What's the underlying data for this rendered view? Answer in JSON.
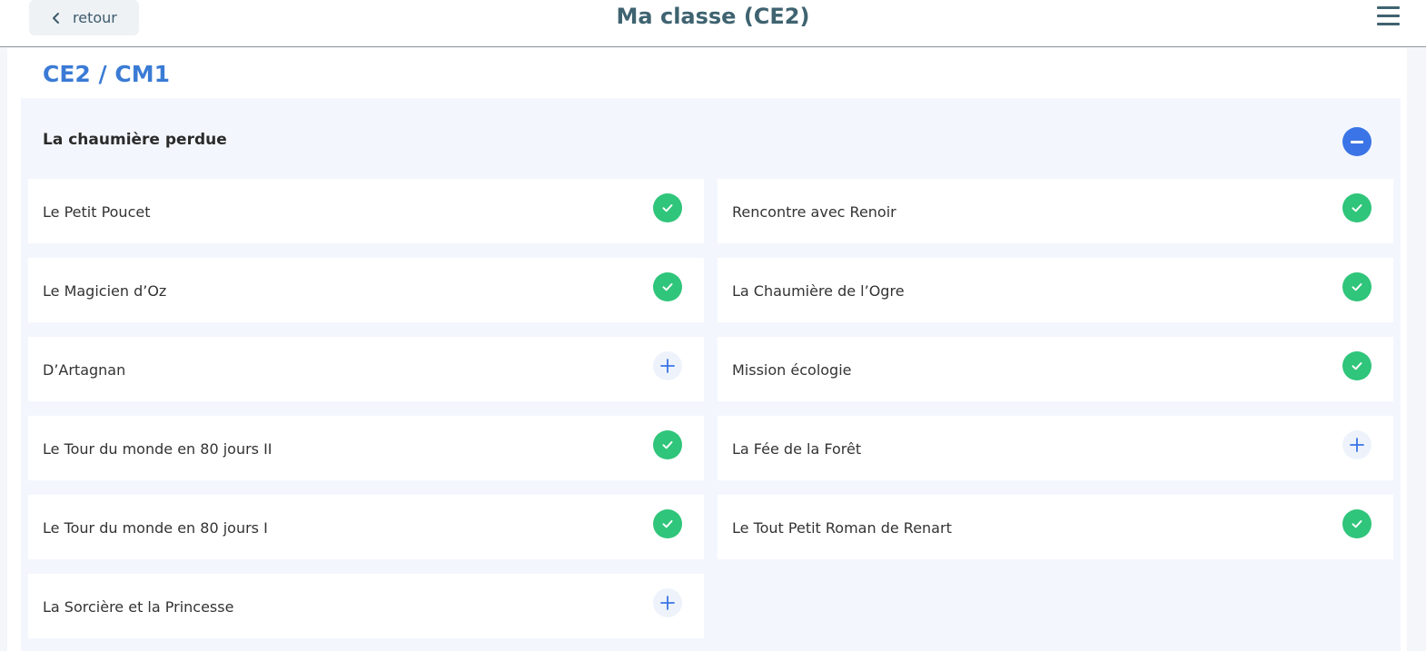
{
  "header": {
    "back_label": "retour",
    "title": "Ma classe (CE2)"
  },
  "section": {
    "title": "CE2 / CM1"
  },
  "panel": {
    "title": "La chaumière perdue"
  },
  "colors": {
    "accent": "#3a7bd5",
    "done": "#2fc57a",
    "title": "#3f6370"
  },
  "items": [
    {
      "label": "Le Petit Poucet",
      "status": "done"
    },
    {
      "label": "Rencontre avec Renoir",
      "status": "done"
    },
    {
      "label": "Le Magicien d’Oz",
      "status": "done"
    },
    {
      "label": "La Chaumière de l’Ogre",
      "status": "done"
    },
    {
      "label": "D’Artagnan",
      "status": "add"
    },
    {
      "label": "Mission écologie",
      "status": "done"
    },
    {
      "label": "Le Tour du monde en 80 jours II",
      "status": "done"
    },
    {
      "label": "La Fée de la Forêt",
      "status": "add"
    },
    {
      "label": "Le Tour du monde en 80 jours I",
      "status": "done"
    },
    {
      "label": "Le Tout Petit Roman de Renart",
      "status": "done"
    },
    {
      "label": "La Sorcière et la Princesse",
      "status": "add"
    }
  ]
}
